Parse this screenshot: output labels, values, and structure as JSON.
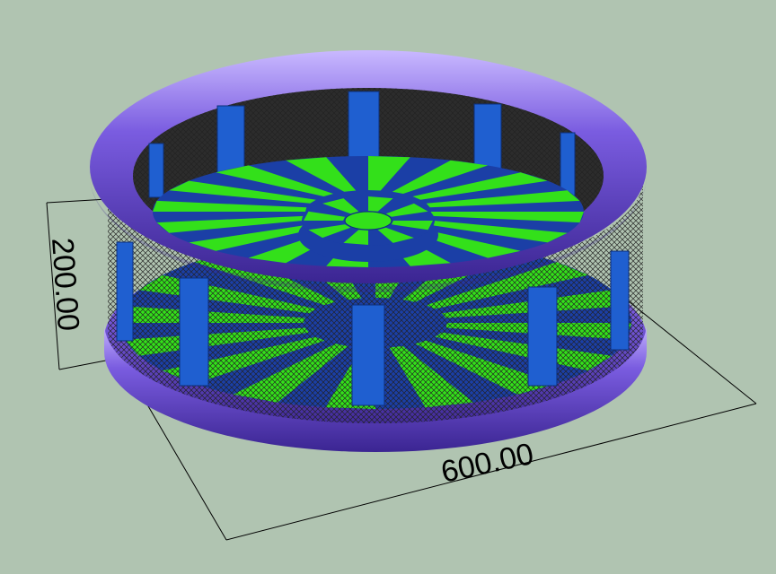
{
  "viewport": {
    "background_color": "#b0c4b1"
  },
  "model": {
    "ring_color": "#6b4fd0",
    "ring_highlight_color": "#c8b8ff",
    "post_color": "#1f5fd0",
    "floor_colors": [
      "#33e01a",
      "#1b3fa6"
    ],
    "net_color": "#2b2b2b",
    "icon": "inflatable-round-bouncer"
  },
  "dimensions": {
    "height_label": "200.00",
    "width_label": "600.00",
    "line_color": "#000000"
  }
}
